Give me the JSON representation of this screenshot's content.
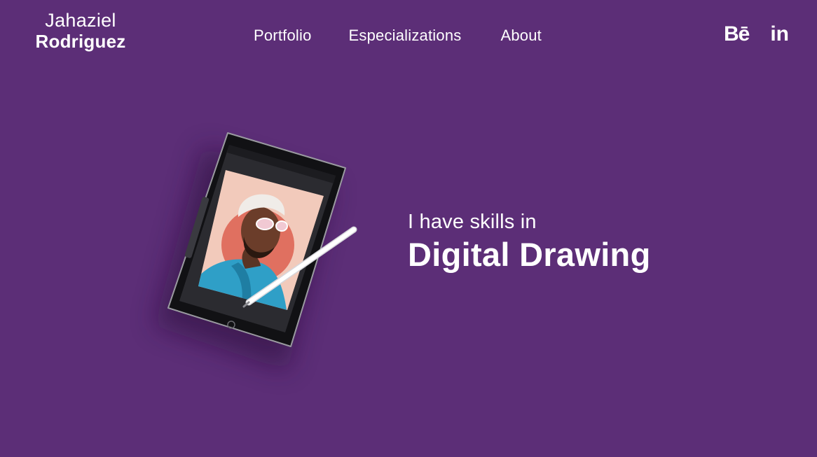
{
  "logo": {
    "first_name": "Jahaziel",
    "last_name": "Rodriguez"
  },
  "nav": {
    "items": [
      {
        "label": "Portfolio"
      },
      {
        "label": "Especializations"
      },
      {
        "label": "About"
      }
    ]
  },
  "social": {
    "behance_label": "Bē",
    "linkedin_label": "in"
  },
  "hero": {
    "subtitle": "I have skills in",
    "title": "Digital Drawing"
  },
  "colors": {
    "background": "#5c2e77",
    "text": "#ffffff",
    "tablet_screen_bg": "#f2cabb",
    "circle": "#e07060",
    "shirt": "#2f9fc7"
  },
  "illustration": {
    "icon": "tablet-with-stylus-icon"
  }
}
